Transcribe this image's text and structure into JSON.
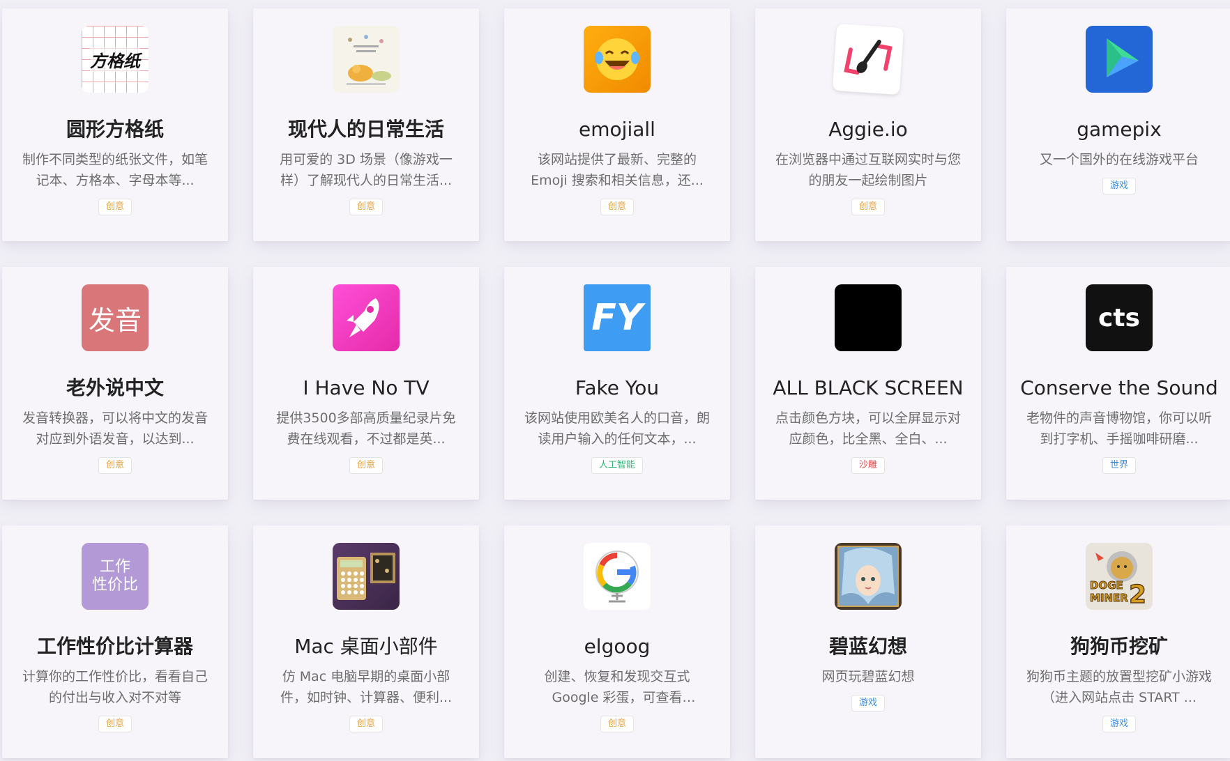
{
  "cards": [
    {
      "title": "圆形方格纸",
      "desc": "制作不同类型的纸张文件，如笔记本、方格本、字母本等...",
      "tag": "创意",
      "icon_name": "graph-paper-icon",
      "icon_text": "方格纸"
    },
    {
      "title": "现代人的日常生活",
      "desc": "用可爱的 3D 场景（像游戏一样）了解现代人的日常生活...",
      "tag": "创意",
      "icon_name": "cartoon-scene-icon"
    },
    {
      "title": "emojiall",
      "desc": "该网站提供了最新、完整的 Emoji 搜索和相关信息，还...",
      "tag": "创意",
      "icon_name": "laughing-emoji-icon"
    },
    {
      "title": "Aggie.io",
      "desc": "在浏览器中通过互联网实时与您的朋友一起绘制图片",
      "tag": "创意",
      "icon_name": "paintbrush-icon"
    },
    {
      "title": "gamepix",
      "desc": "又一个国外的在线游戏平台",
      "tag": "游戏",
      "icon_name": "play-triangle-icon"
    },
    {
      "title": "老外说中文",
      "desc": "发音转换器，可以将中文的发音对应到外语发音，以达到...",
      "tag": "创意",
      "icon_name": "pronunciation-icon",
      "icon_text": "发音"
    },
    {
      "title": "I Have No TV",
      "desc": "提供3500多部高质量纪录片免费在线观看，不过都是英...",
      "tag": "创意",
      "icon_name": "rocket-icon"
    },
    {
      "title": "Fake You",
      "desc": "该网站使用欧美名人的口音，朗读用户输入的任何文本，...",
      "tag": "人工智能",
      "icon_name": "fy-logo-icon",
      "icon_text": "FY"
    },
    {
      "title": "ALL BLACK SCREEN",
      "desc": "点击颜色方块，可以全屏显示对应颜色，比全黑、全白、...",
      "tag": "沙雕",
      "icon_name": "black-square-icon"
    },
    {
      "title": "Conserve the Sound",
      "desc": "老物件的声音博物馆，你可以听到打字机、手摇咖啡研磨...",
      "tag": "世界",
      "icon_name": "cts-logo-icon",
      "icon_text": "cts"
    },
    {
      "title": "工作性价比计算器",
      "desc": "计算你的工作性价比，看看自己的付出与收入对不对等",
      "tag": "创意",
      "icon_name": "work-value-icon",
      "icon_text_1": "工作",
      "icon_text_2": "性价比"
    },
    {
      "title": "Mac 桌面小部件",
      "desc": "仿 Mac 电脑早期的桌面小部件，如时钟、计算器、便利...",
      "tag": "创意",
      "icon_name": "calculator-icon"
    },
    {
      "title": "elgoog",
      "desc": "创建、恢复和发现交互式 Google 彩蛋，可查看 Google...",
      "tag": "创意",
      "icon_name": "globe-g-icon"
    },
    {
      "title": "碧蓝幻想",
      "desc": "网页玩碧蓝幻想",
      "tag": "游戏",
      "icon_name": "anime-character-icon"
    },
    {
      "title": "狗狗币挖矿",
      "desc": "狗狗币主题的放置型挖矿小游戏（进入网站点击 START ...",
      "tag": "游戏",
      "icon_name": "doge-miner-icon",
      "icon_text": "DOGE MINER 2"
    }
  ]
}
